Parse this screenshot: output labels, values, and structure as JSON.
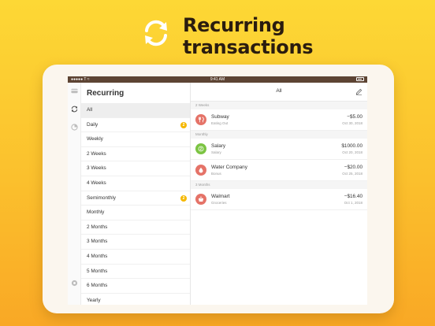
{
  "hero": {
    "title_line1": "Recurring",
    "title_line2": "transactions",
    "icon": "refresh-icon"
  },
  "statusbar": {
    "left": "●●●●● T ≈",
    "time": "9:41 AM"
  },
  "rail": {
    "icons": [
      "card-icon",
      "recurring-icon",
      "pie-chart-icon",
      "settings-icon"
    ]
  },
  "sidebar": {
    "title": "Recurring",
    "items": [
      {
        "label": "All",
        "selected": true,
        "badge": ""
      },
      {
        "label": "Daily",
        "badge": "2"
      },
      {
        "label": "Weekly",
        "badge": ""
      },
      {
        "label": "2 Weeks",
        "badge": ""
      },
      {
        "label": "3 Weeks",
        "badge": ""
      },
      {
        "label": "4 Weeks",
        "badge": ""
      },
      {
        "label": "Semimonthly",
        "badge": "2"
      },
      {
        "label": "Monthly",
        "badge": ""
      },
      {
        "label": "2 Months",
        "badge": ""
      },
      {
        "label": "3 Months",
        "badge": ""
      },
      {
        "label": "4 Months",
        "badge": ""
      },
      {
        "label": "5 Months",
        "badge": ""
      },
      {
        "label": "6 Months",
        "badge": ""
      },
      {
        "label": "Yearly",
        "badge": ""
      }
    ]
  },
  "main": {
    "title": "All",
    "sections": [
      {
        "header": "2 Weeks",
        "transactions": [
          {
            "name": "Subway",
            "category": "Eating Out",
            "amount": "−$5.00",
            "date": "Oct 30, 2018",
            "color": "#e57368",
            "icon": "utensils-icon"
          }
        ]
      },
      {
        "header": "Monthly",
        "transactions": [
          {
            "name": "Salary",
            "category": "Salary",
            "amount": "$1000.00",
            "date": "Oct 20, 2018",
            "color": "#7cc443",
            "icon": "money-icon"
          },
          {
            "name": "Water Company",
            "category": "Bonus",
            "amount": "−$20.00",
            "date": "Oct 25, 2018",
            "color": "#e57368",
            "icon": "droplet-icon"
          }
        ]
      },
      {
        "header": "3 Months",
        "transactions": [
          {
            "name": "Walmart",
            "category": "Groceries",
            "amount": "−$16.40",
            "date": "Oct 1, 2018",
            "color": "#e57368",
            "icon": "basket-icon"
          }
        ]
      }
    ]
  },
  "colors": {
    "background": "#fbc02d",
    "statusbar": "#5d4433",
    "badge": "#f5b800",
    "expense": "#e57368",
    "income": "#7cc443"
  }
}
